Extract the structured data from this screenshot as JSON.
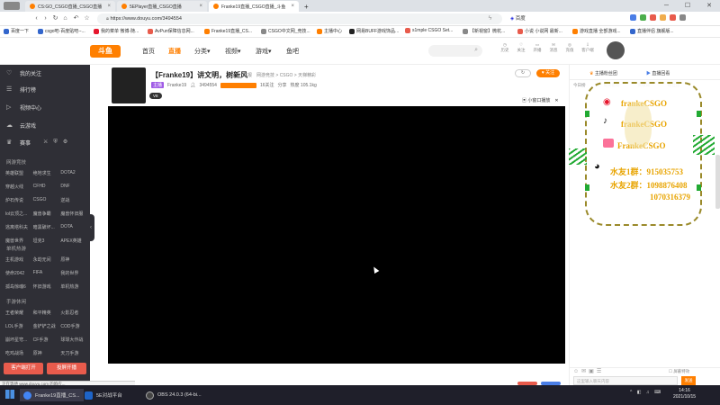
{
  "browser": {
    "tabs": [
      {
        "label": "CS:GO_CSGO直播_CSGO直播",
        "color": "#ff7f00",
        "active": false
      },
      {
        "label": "5EPlayer直播_CSGO直播",
        "color": "#ff7f00",
        "active": false
      },
      {
        "label": "Franke19直播_CSGO直播_斗鱼",
        "color": "#ff7f00",
        "active": true
      }
    ],
    "new_tab": "+",
    "url": "https://www.douyu.com/3494554",
    "search_engine": "百度",
    "bookmarks": [
      {
        "label": "百度一下",
        "color": "#3366cc"
      },
      {
        "label": "csgo吧-百度贴吧--...",
        "color": "#3366cc"
      },
      {
        "label": "我的菜单 微博-随...",
        "color": "#e6162d"
      },
      {
        "label": "AvPun保障信息网...",
        "color": "#e85b4c"
      },
      {
        "label": "Franke19直播_CS...",
        "color": "#ff7f00"
      },
      {
        "label": "CSGO中文网_竞技...",
        "color": "#888888"
      },
      {
        "label": "主播中心",
        "color": "#ff7f00"
      },
      {
        "label": "网易BUFF游戏饰品...",
        "color": "#222222"
      },
      {
        "label": "s1mple CSGO Set...",
        "color": "#e85b4c"
      },
      {
        "label": "【新視窗】微杭...",
        "color": "#888888"
      },
      {
        "label": "小说 小说网 最新...",
        "color": "#e85b4c"
      },
      {
        "label": "游戏直播 全部游戏...",
        "color": "#ff7f00"
      },
      {
        "label": "直播伴侣 旗舰版...",
        "color": "#3366cc"
      }
    ]
  },
  "site": {
    "logo": "斗鱼",
    "nav": [
      "首页",
      "直播",
      "分类",
      "视频",
      "游戏",
      "鱼吧"
    ],
    "active_nav": "直播",
    "header_icons": [
      {
        "icon": "history-icon",
        "label": "历史"
      },
      {
        "icon": "follow-icon",
        "label": "关注"
      },
      {
        "icon": "broadcast-icon",
        "label": "开播"
      },
      {
        "icon": "message-icon",
        "label": "消息"
      },
      {
        "icon": "recharge-icon",
        "label": "充值"
      },
      {
        "icon": "download-icon",
        "label": "客户端"
      }
    ]
  },
  "sidebar": {
    "items": [
      {
        "icon": "heart-icon",
        "label": "我的关注"
      },
      {
        "icon": "list-icon",
        "label": "排行榜"
      },
      {
        "icon": "video-icon",
        "label": "视频中心"
      },
      {
        "icon": "cloud-icon",
        "label": "云游戏"
      },
      {
        "icon": "trophy-icon",
        "label": "赛事"
      }
    ],
    "sections": [
      {
        "title": "网游竞技",
        "games": [
          "英雄联盟",
          "绝地求生",
          "DOTA2",
          "穿越火线",
          "CFHD",
          "DNF",
          "炉石传说",
          "CSGO",
          "逆战",
          "lol云顶之...",
          "魔兽争霸",
          "魔兽怀旧服",
          "逃离塔科夫",
          "暗黑破坏...",
          "DOTA",
          "魔兽世界",
          "坦克3",
          "APEX英雄"
        ]
      },
      {
        "title": "单机热游",
        "games": [
          "主机游戏",
          "永劫无间",
          "原神",
          "使命2042",
          "FIFA",
          "我的世界",
          "孤岛惊魂6",
          "怀旧游戏",
          "单机热游"
        ]
      },
      {
        "title": "手游休闲",
        "games": [
          "王者荣耀",
          "和平精英",
          "火影忍者",
          "LOL手游",
          "金铲铲之战",
          "COD手游",
          "崩坏星穹...",
          "CF手游",
          "球球大作战",
          "吃鸡战场",
          "原神",
          "天刀手游"
        ]
      }
    ],
    "buttons": [
      "客户端打开",
      "投屏开播"
    ]
  },
  "room": {
    "title": "【Franke19】讲文明，树新风",
    "tag": "举报",
    "category": "网游竞技 > CSGO > 天梯精彩",
    "badge": "主播",
    "streamer": "Franke19",
    "room_id": "3494554",
    "level_tag": "V8",
    "followers": "16关注",
    "share": "分享",
    "hotness": "热度 105.1kg",
    "follow_btn": "关注",
    "mini_window": "小窗口播放"
  },
  "chat": {
    "tabs": [
      "主播粉丝团",
      "直播回看"
    ],
    "sub_tabs": [
      "今日榜",
      "周贡献榜",
      "贡献日",
      "粉丝团"
    ],
    "input_placeholder": "这里输入聊天内容",
    "send_btn": "发送",
    "option": "屏蔽特效"
  },
  "overlay": {
    "weibo": "frankeCSGO",
    "douyin": "frankeCSGO",
    "bilibili": "FrankeCSGO",
    "qq_group_1": "水友1群：915035753",
    "qq_group_2": "水友2群：1098876408",
    "qq_group_3": "1070316379"
  },
  "statusbar": "正在等待 www.douyu.com 的响应...",
  "taskbar": {
    "apps": [
      {
        "label": "Franke19直播_CS...",
        "color": "#4285f4"
      },
      {
        "label": "5E对战平台",
        "color": "#1e64c8"
      },
      {
        "label": "OBS 24.0.3 (64-bi...",
        "color": "#444"
      }
    ],
    "time": "14:16",
    "date": "2021/10/15"
  }
}
